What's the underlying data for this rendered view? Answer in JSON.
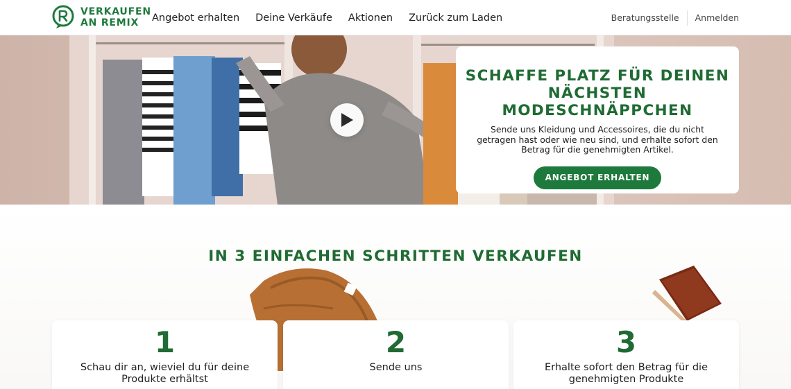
{
  "brand": {
    "name_line1": "VERKAUFEN",
    "name_line2": "AN REMIX",
    "accent_color": "#1e7a3c"
  },
  "nav": {
    "items": [
      {
        "label": "Angebot erhalten"
      },
      {
        "label": "Deine Verkäufe"
      },
      {
        "label": "Aktionen"
      },
      {
        "label": "Zurück zum Laden"
      }
    ],
    "right": {
      "help": "Beratungsstelle",
      "login": "Anmelden"
    }
  },
  "hero": {
    "video_icon": "play-icon",
    "title_line1": "SCHAFFE PLATZ FÜR DEINEN",
    "title_line2": "NÄCHSTEN MODESCHNÄPPCHEN",
    "text": "Sende uns Kleidung und Accessoires, die du nicht getragen hast oder wie neu sind, und erhalte sofort den Betrag für die genehmigten Artikel.",
    "cta": "ANGEBOT ERHALTEN"
  },
  "steps": {
    "heading": "IN 3 EINFACHEN SCHRITTEN VERKAUFEN",
    "items": [
      {
        "number": "1",
        "text": "Schau dir an, wieviel du für deine Produkte erhältst"
      },
      {
        "number": "2",
        "text": "Sende uns"
      },
      {
        "number": "3",
        "text": "Erhalte sofort den Betrag für die genehmigten Produkte"
      }
    ]
  }
}
